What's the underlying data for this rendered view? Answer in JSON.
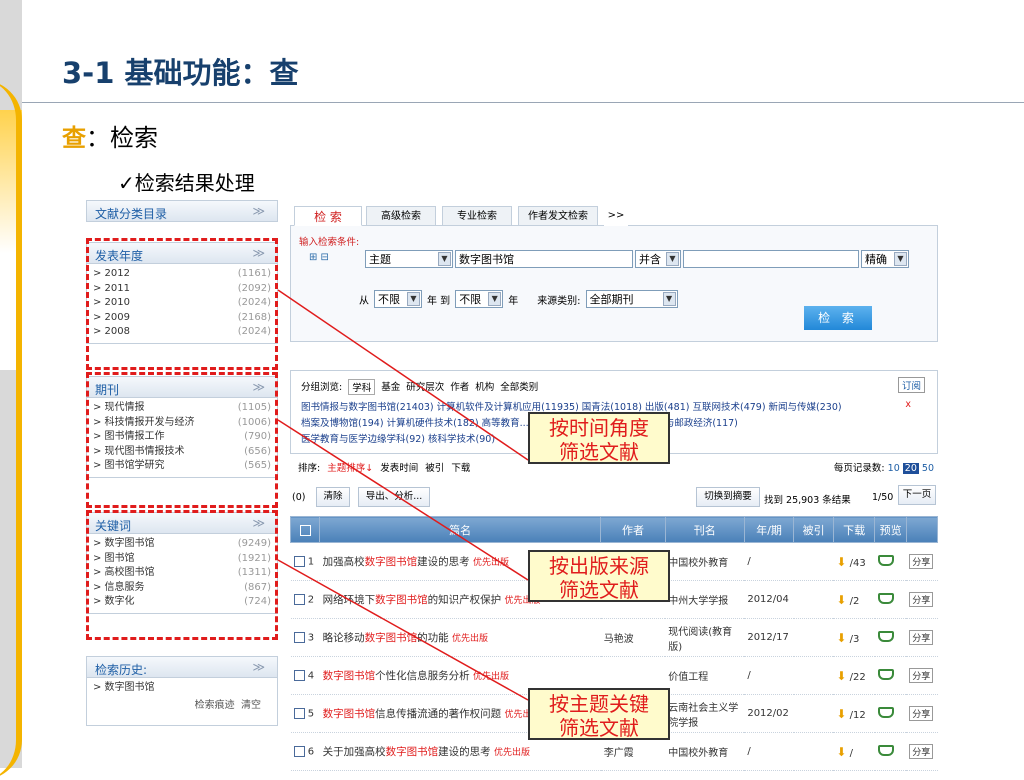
{
  "slide": {
    "title": "3-1 基础功能：查",
    "subtitle_key": "查",
    "subtitle_rest": "：检索",
    "subsub": "✓检索结果处理"
  },
  "left_panel": {
    "catalog": {
      "label": "文献分类目录"
    },
    "year": {
      "label": "发表年度",
      "items": [
        {
          "label": "> 2012",
          "count": "(1161)"
        },
        {
          "label": "> 2011",
          "count": "(2092)"
        },
        {
          "label": "> 2010",
          "count": "(2024)"
        },
        {
          "label": "> 2009",
          "count": "(2168)"
        },
        {
          "label": "> 2008",
          "count": "(2024)"
        }
      ]
    },
    "journal": {
      "label": "期刊",
      "items": [
        {
          "label": "> 现代情报",
          "count": "(1105)"
        },
        {
          "label": "> 科技情报开发与经济",
          "count": "(1006)"
        },
        {
          "label": "> 图书情报工作",
          "count": "(790)"
        },
        {
          "label": "> 现代图书情报技术",
          "count": "(656)"
        },
        {
          "label": "> 图书馆学研究",
          "count": "(565)"
        }
      ]
    },
    "keyword": {
      "label": "关键词",
      "items": [
        {
          "label": "> 数字图书馆",
          "count": "(9249)"
        },
        {
          "label": "> 图书馆",
          "count": "(1921)"
        },
        {
          "label": "> 高校图书馆",
          "count": "(1311)"
        },
        {
          "label": "> 信息服务",
          "count": "(867)"
        },
        {
          "label": "> 数字化",
          "count": "(724)"
        }
      ]
    },
    "history": {
      "label": "检索历史:",
      "item": "> 数字图书馆",
      "trace": "检索痕迹",
      "clear": "清空"
    }
  },
  "search": {
    "tabs": [
      "检 索",
      "高级检索",
      "专业检索",
      "作者发文检索",
      ">>"
    ],
    "condition_label": "输入检索条件:",
    "field": "主题",
    "query": "数字图书馆",
    "logic": "并含",
    "query2": "",
    "match": "精确",
    "from_label": "从",
    "from_value": "不限",
    "year_to": "年 到",
    "to_value": "不限",
    "year_end": "年",
    "source_label": "来源类别:",
    "source_value": "全部期刊",
    "button": "检 索"
  },
  "groups": {
    "browse_label": "分组浏览:",
    "options": [
      "学科",
      "基金",
      "研究层次",
      "作者",
      "机构",
      "全部类别"
    ],
    "subscribe": "订阅",
    "line1": "图书情报与数字图书馆(21403)  计算机软件及计算机应用(11935)  国青法(1018)  出版(481)  互联网技术(479)  新闻与传媒(230)",
    "line1_close": "x",
    "line2": "档案及博物馆(194)  计算机硬件技术(182)  高等教育...                                 (153)  工业经济(119)  信息经济与邮政经济(117)",
    "line3": "医学教育与医学边缘学科(92)  核科学技术(90)"
  },
  "sorting": {
    "label": "排序:",
    "active": "主题排序↓",
    "others": [
      "发表时间",
      "被引",
      "下载"
    ],
    "per_page_label": "每页记录数:",
    "per_page": [
      "10",
      "20",
      "50"
    ],
    "selected_count_prefix": "(0)",
    "clear": "清除",
    "export": "导出、分析...",
    "switch": "切换到摘要",
    "found": "找到 25,903 条结果",
    "page": "1/50",
    "next": "下一页"
  },
  "table": {
    "headers": [
      "篇名",
      "作者",
      "刊名",
      "年/期",
      "被引",
      "下载",
      "预览"
    ],
    "rows": [
      {
        "n": "1",
        "pre": "加强高校",
        "hl": "数字图书馆",
        "post": "建设的思考",
        "tag": "优先出版",
        "author": "李广霞",
        "journal": "中国校外教育",
        "issue": "/",
        "dl": "43",
        "share": "分享"
      },
      {
        "n": "2",
        "pre": "网络环境下",
        "hl": "数字图书馆",
        "post": "的知识产权保护",
        "tag": "优先出版",
        "author": "",
        "journal": "中州大学学报",
        "issue": "2012/04",
        "dl": "2",
        "share": "分享"
      },
      {
        "n": "3",
        "pre": "略论移动",
        "hl": "数字图书馆",
        "post": "的功能",
        "tag": "优先出版",
        "author": "马艳波",
        "journal": "现代阅读(教育版)",
        "issue": "2012/17",
        "dl": "3",
        "share": "分享"
      },
      {
        "n": "4",
        "pre": "",
        "hl": "数字图书馆",
        "post": "个性化信息服务分析",
        "tag": "优先出版",
        "author": "",
        "journal": "价值工程",
        "issue": "/",
        "dl": "22",
        "share": "分享"
      },
      {
        "n": "5",
        "pre": "",
        "hl": "数字图书馆",
        "post": "信息传播流通的著作权问题",
        "tag": "优先出版",
        "author": "",
        "journal": "云南社会主义学院学报",
        "issue": "2012/02",
        "dl": "12",
        "share": "分享"
      },
      {
        "n": "6",
        "pre": "关于加强高校",
        "hl": "数字图书馆",
        "post": "建设的思考",
        "tag": "优先出版",
        "author": "李广霞",
        "journal": "中国校外教育",
        "issue": "/",
        "dl": "",
        "share": "分享"
      }
    ]
  },
  "callouts": {
    "time": "按时间角度\n筛选文献",
    "source": "按出版来源\n筛选文献",
    "topic": "按主题关键\n筛选文献"
  },
  "colors": {
    "accent_red": "#e01c1c",
    "title_blue": "#17406d",
    "gold": "#f4b400",
    "header_blue": "#4a80b8"
  }
}
